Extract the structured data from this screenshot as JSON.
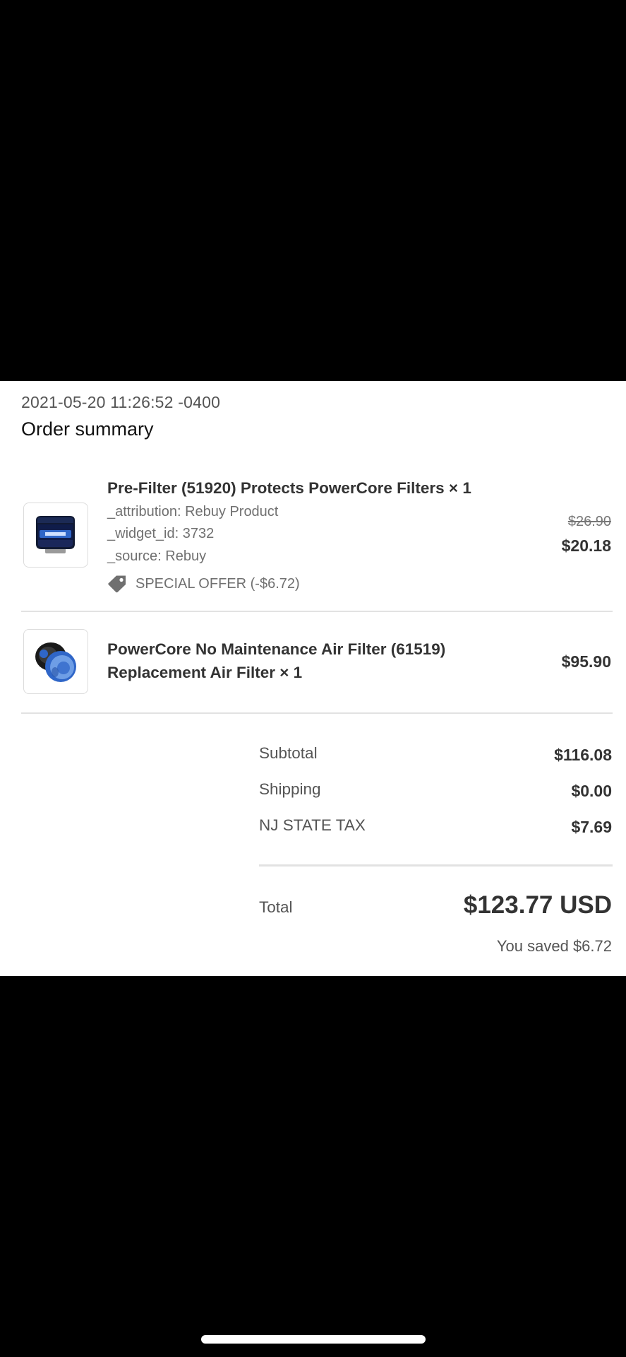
{
  "order": {
    "timestamp": "2021-05-20 11:26:52 -0400",
    "title": "Order summary"
  },
  "items": [
    {
      "title": "Pre-Filter (51920) Protects PowerCore Filters × 1",
      "properties": [
        "_attribution: Rebuy Product",
        "_widget_id: 3732",
        "_source: Rebuy"
      ],
      "discount": "SPECIAL OFFER (-$6.72)",
      "original_price": "$26.90",
      "price": "$20.18",
      "icon": "pre-filter-product-image"
    },
    {
      "title_line1": "PowerCore No Maintenance Air Filter (61519)",
      "title_line2": "Replacement Air Filter × 1",
      "price": "$95.90",
      "icon": "air-filter-product-image"
    }
  ],
  "totals": {
    "subtotal_label": "Subtotal",
    "subtotal_value": "$116.08",
    "shipping_label": "Shipping",
    "shipping_value": "$0.00",
    "tax_label": "NJ STATE TAX",
    "tax_value": "$7.69",
    "total_label": "Total",
    "total_value": "$123.77 USD",
    "saved": "You saved $6.72"
  },
  "colors": {
    "background": "#000000",
    "card": "#ffffff",
    "text_primary": "#333333",
    "text_secondary": "#707070",
    "divider": "#e2e2e2",
    "filter_blue": "#2f66c8"
  }
}
